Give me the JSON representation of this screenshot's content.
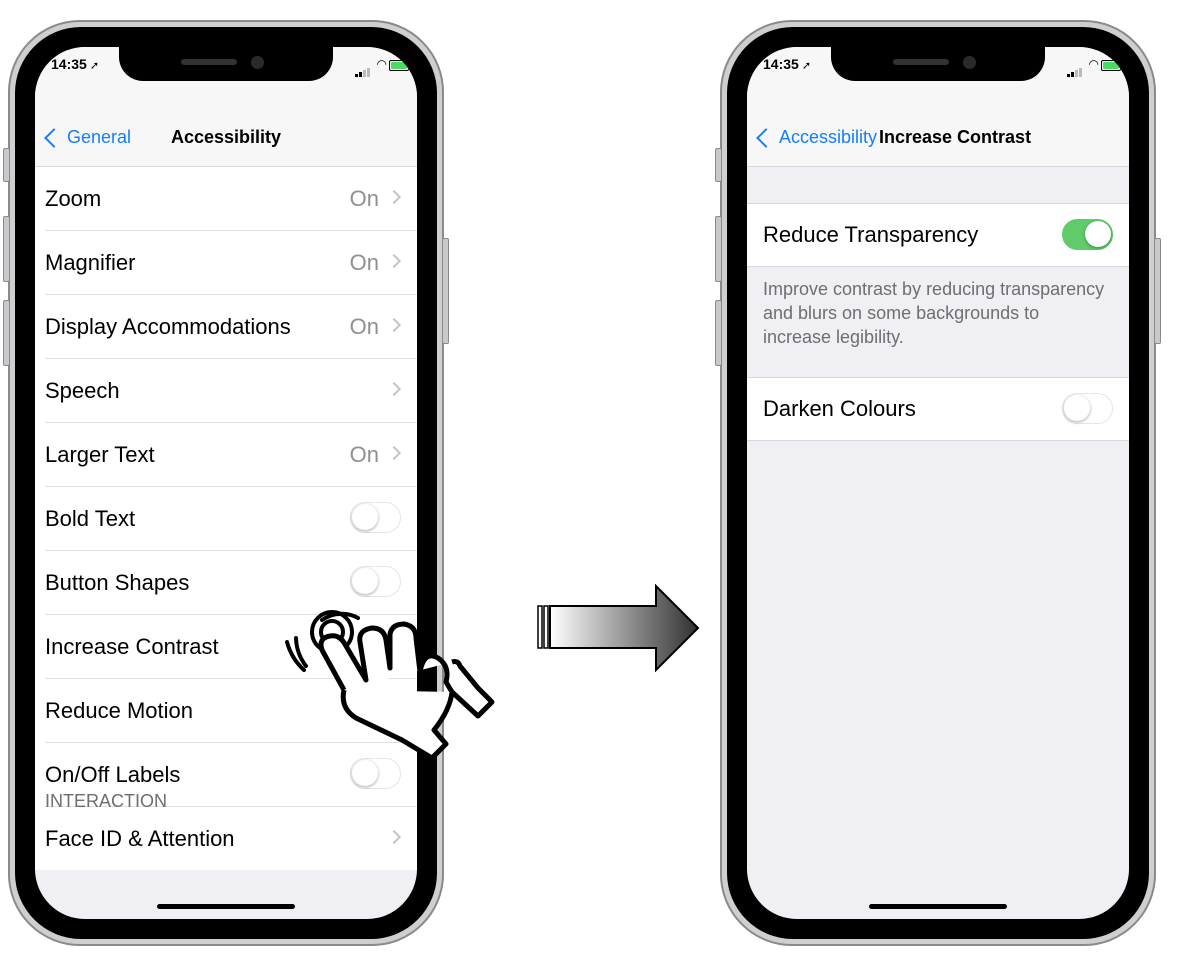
{
  "left_phone": {
    "status": {
      "time": "14:35",
      "location_icon": "location-arrow-icon"
    },
    "nav": {
      "back_label": "General",
      "title": "Accessibility"
    },
    "rows": [
      {
        "label": "Zoom",
        "value": "On",
        "type": "link"
      },
      {
        "label": "Magnifier",
        "value": "On",
        "type": "link"
      },
      {
        "label": "Display Accommodations",
        "value": "On",
        "type": "link"
      },
      {
        "label": "Speech",
        "value": "",
        "type": "link"
      },
      {
        "label": "Larger Text",
        "value": "On",
        "type": "link"
      },
      {
        "label": "Bold Text",
        "type": "toggle",
        "on": false
      },
      {
        "label": "Button Shapes",
        "type": "toggle",
        "on": false
      },
      {
        "label": "Increase Contrast",
        "value": "",
        "type": "link"
      },
      {
        "label": "Reduce Motion",
        "value": "",
        "type": "link"
      },
      {
        "label": "On/Off Labels",
        "type": "toggle",
        "on": false
      },
      {
        "label": "Face ID & Attention",
        "value": "",
        "type": "link"
      }
    ],
    "section_header": "INTERACTION"
  },
  "right_phone": {
    "status": {
      "time": "14:35",
      "location_icon": "location-arrow-icon"
    },
    "nav": {
      "back_label": "Accessibility",
      "title": "Increase Contrast"
    },
    "reduce_transparency": {
      "label": "Reduce Transparency",
      "on": true
    },
    "footer": "Improve contrast by reducing transparency and blurs on some backgrounds to increase legibility.",
    "darken_colours": {
      "label": "Darken Colours",
      "on": false
    }
  },
  "colors": {
    "accent": "#147efb",
    "toggle_on": "#5fcb6a",
    "group_bg": "#efeff4"
  },
  "icons": {
    "tap_hand": "tap-hand-icon",
    "transition_arrow": "right-arrow-icon"
  }
}
